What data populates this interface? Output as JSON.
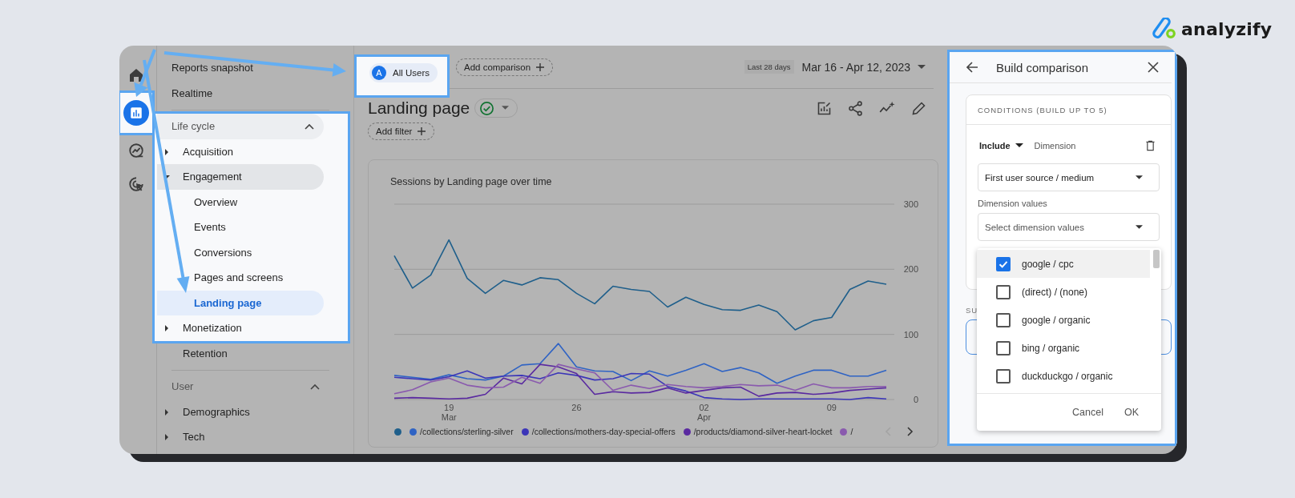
{
  "brand": {
    "name": "analyzify"
  },
  "rail": [
    {
      "kind": "home",
      "selected": false,
      "highlighted": false
    },
    {
      "kind": "reports",
      "selected": true,
      "highlighted": true
    },
    {
      "kind": "explore",
      "selected": false,
      "highlighted": false
    },
    {
      "kind": "advertising",
      "selected": false,
      "highlighted": false
    }
  ],
  "nav": {
    "top_items": [
      {
        "label": "Reports snapshot",
        "selected": false
      },
      {
        "label": "Realtime",
        "selected": false
      }
    ],
    "sections": [
      {
        "title": "Life cycle",
        "expanded": true,
        "highlighted": true,
        "items": [
          {
            "label": "Acquisition",
            "kind": "group",
            "expanded": false,
            "selected": false,
            "highlighted": true
          },
          {
            "label": "Engagement",
            "kind": "group",
            "expanded": true,
            "selected": false,
            "highlighted": true,
            "children": [
              {
                "label": "Overview",
                "selected": false,
                "highlighted": true
              },
              {
                "label": "Events",
                "selected": false,
                "highlighted": true
              },
              {
                "label": "Conversions",
                "selected": false,
                "highlighted": true
              },
              {
                "label": "Pages and screens",
                "selected": false,
                "highlighted": true
              },
              {
                "label": "Landing page",
                "selected": true,
                "highlighted": true
              }
            ]
          },
          {
            "label": "Monetization",
            "kind": "group",
            "expanded": false,
            "selected": false,
            "highlighted": true
          },
          {
            "label": "Retention",
            "kind": "page",
            "selected": false,
            "highlighted": false
          }
        ]
      },
      {
        "title": "User",
        "expanded": true,
        "highlighted": false,
        "items": [
          {
            "label": "Demographics",
            "kind": "group",
            "expanded": false,
            "selected": false,
            "highlighted": false
          },
          {
            "label": "Tech",
            "kind": "group",
            "expanded": false,
            "selected": false,
            "highlighted": false
          }
        ]
      }
    ]
  },
  "comparison_bar": {
    "segment": {
      "badge": "A",
      "label": "All Users",
      "highlighted": true
    },
    "add_comparison": "Add comparison",
    "date_preset": "Last 28 days",
    "date_range": "Mar 16 - Apr 12, 2023"
  },
  "report": {
    "title": "Landing page",
    "add_filter": "Add filter"
  },
  "chart": {
    "title": "Sessions by Landing page over time",
    "chart_data": {
      "type": "line",
      "categories": [
        null,
        null,
        null,
        "19 Mar",
        null,
        null,
        null,
        null,
        null,
        null,
        "26",
        null,
        null,
        null,
        null,
        null,
        null,
        "02 Apr",
        null,
        null,
        null,
        null,
        null,
        null,
        "09",
        null,
        null,
        null
      ],
      "ylim": [
        0,
        300
      ],
      "yticks": [
        0,
        100,
        200,
        300
      ],
      "series": [
        {
          "color": "#1f5f8b",
          "values": [
            221,
            171,
            191,
            245,
            186,
            163,
            183,
            176,
            187,
            184,
            163,
            147,
            174,
            169,
            166,
            142,
            157,
            146,
            138,
            137,
            145,
            135,
            107,
            121,
            126,
            169,
            182,
            177
          ]
        },
        {
          "name": "/collections/sterling-silver",
          "color": "#2f63c4",
          "values": [
            37,
            34,
            31,
            38,
            32,
            30,
            36,
            53,
            55,
            86,
            50,
            44,
            43,
            29,
            44,
            36,
            45,
            55,
            43,
            49,
            41,
            25,
            36,
            45,
            45,
            36,
            36,
            45
          ]
        },
        {
          "name": "/collections/mothers-day-special-offers",
          "color": "#3c36b8",
          "values": [
            34,
            32,
            30,
            35,
            44,
            33,
            36,
            37,
            32,
            41,
            37,
            30,
            32,
            40,
            39,
            20,
            13,
            3,
            1,
            0,
            1,
            1,
            1,
            1,
            1,
            0,
            3,
            1
          ]
        },
        {
          "name": "/products/diamond-silver-heart-locket",
          "color": "#5a2aa0",
          "values": [
            2,
            3,
            2,
            1,
            2,
            8,
            33,
            24,
            54,
            50,
            40,
            8,
            12,
            10,
            11,
            18,
            10,
            14,
            18,
            19,
            5,
            10,
            11,
            8,
            10,
            14,
            16,
            18
          ]
        },
        {
          "name": "/",
          "color": "#8a5aae",
          "values": [
            9,
            15,
            27,
            33,
            22,
            18,
            19,
            34,
            25,
            54,
            47,
            41,
            14,
            22,
            17,
            23,
            20,
            18,
            20,
            23,
            21,
            22,
            14,
            24,
            18,
            18,
            20,
            20
          ]
        }
      ]
    }
  },
  "comparison_panel": {
    "title": "Build comparison",
    "highlighted": true,
    "conditions_title": "CONDITIONS (BUILD UP TO 5)",
    "include": "Include",
    "dimension_label": "Dimension",
    "dimension_value": "First user source / medium",
    "values_label": "Dimension values",
    "values_placeholder": "Select dimension values",
    "summary_label": "SU",
    "options": [
      {
        "label": "google / cpc",
        "checked": true
      },
      {
        "label": "(direct) / (none)",
        "checked": false
      },
      {
        "label": "google / organic",
        "checked": false
      },
      {
        "label": "bing / organic",
        "checked": false
      },
      {
        "label": "duckduckgo / organic",
        "checked": false
      }
    ],
    "cancel": "Cancel",
    "ok": "OK"
  }
}
